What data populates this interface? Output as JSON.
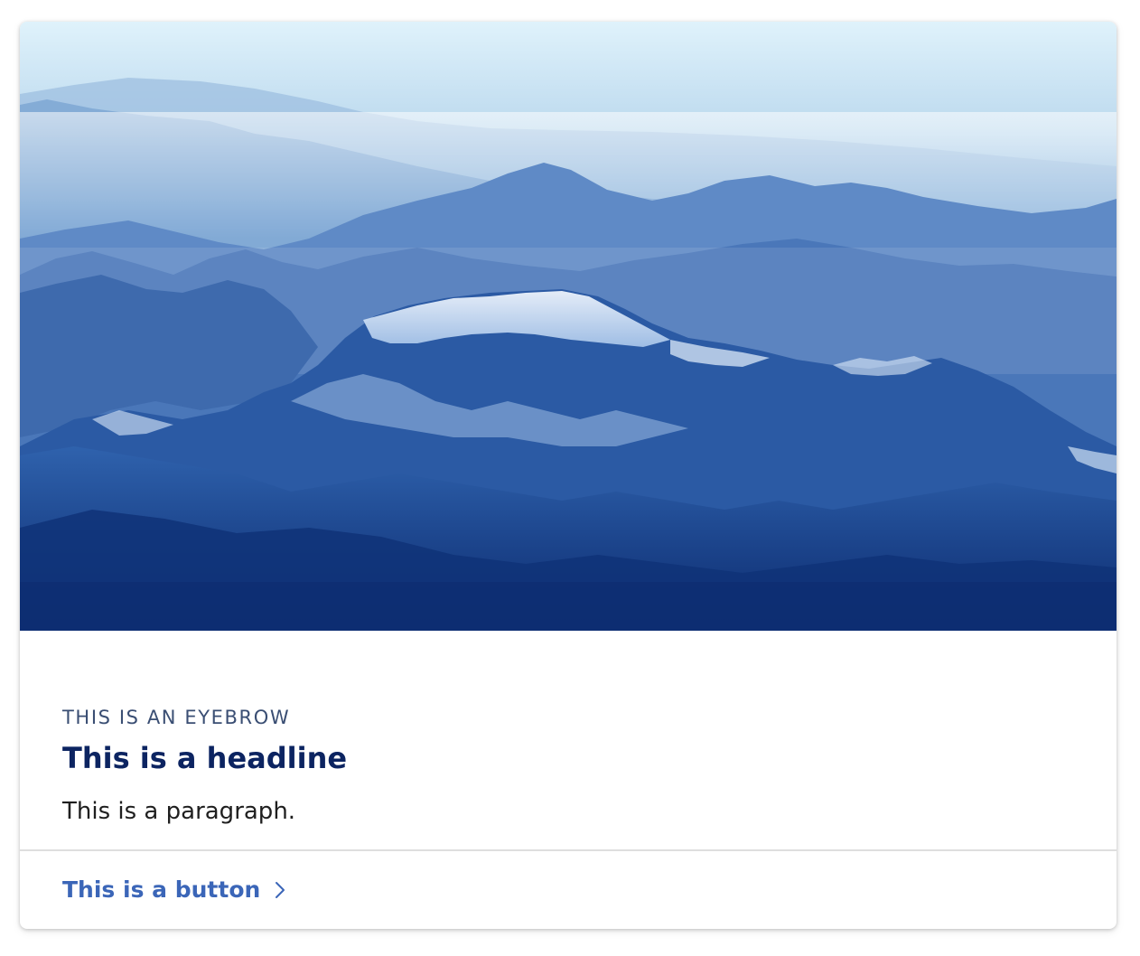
{
  "card": {
    "image": {
      "subject": "aerial view of blue snow-capped mountain ranges with mist",
      "colors": [
        "#dff2fb",
        "#9fc4e3",
        "#4f7fbf",
        "#2a5aa8",
        "#163c8a",
        "#0b2a6e"
      ]
    },
    "eyebrow": "THIS IS AN EYEBROW",
    "headline": "This is a headline",
    "paragraph": "This is a paragraph.",
    "button": {
      "label": "This is a button",
      "icon": "chevron-right-icon"
    }
  },
  "colors": {
    "eyebrow": "#3a4e73",
    "headline": "#0c2461",
    "paragraph": "#1f1f1f",
    "link": "#3b66b8",
    "divider": "#dedede"
  }
}
